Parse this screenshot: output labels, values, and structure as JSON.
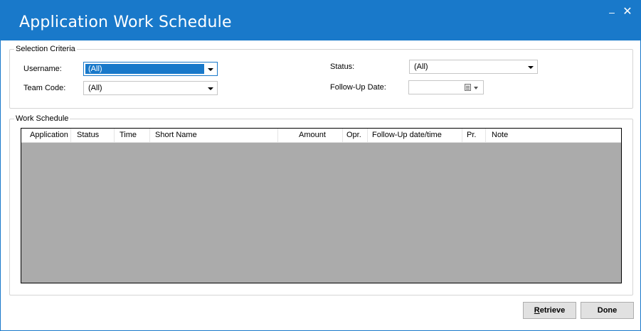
{
  "window": {
    "title": "Application Work Schedule",
    "minimize_glyph": "–",
    "close_glyph": "✕",
    "accent_color": "#1979ca"
  },
  "selection_criteria": {
    "legend": "Selection Criteria",
    "username": {
      "label": "Username:",
      "value": "(All)"
    },
    "team_code": {
      "label": "Team Code:",
      "value": "(All)"
    },
    "status": {
      "label": "Status:",
      "value": "(All)"
    },
    "follow_up_date": {
      "label": "Follow-Up Date:",
      "value": ""
    }
  },
  "work_schedule": {
    "legend": "Work Schedule",
    "columns": [
      "Application",
      "Status",
      "Time",
      "Short Name",
      "Amount",
      "Opr.",
      "Follow-Up date/time",
      "Pr.",
      "Note"
    ],
    "rows": []
  },
  "buttons": {
    "retrieve_first": "R",
    "retrieve_rest": "etrieve",
    "done": "Done"
  }
}
